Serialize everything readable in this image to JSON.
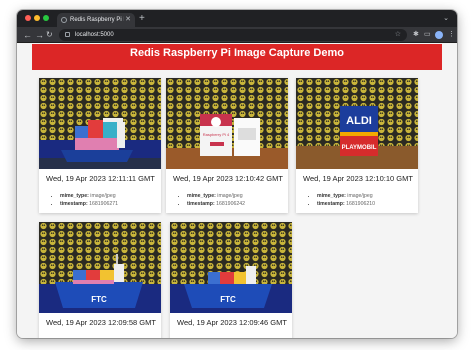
{
  "browser": {
    "tab_title": "Redis Raspberry Pi Image Captu",
    "url": "localhost:5000",
    "icons": [
      "close-icon",
      "plus-icon",
      "back-arrow-icon",
      "forward-arrow-icon",
      "reload-icon",
      "lock-icon",
      "star-icon",
      "extension-icon",
      "menu-icon"
    ]
  },
  "page": {
    "title": "Redis Raspberry Pi Image Capture Demo",
    "accent_color": "#dc2626"
  },
  "cards": [
    {
      "date": "Wed, 19 Apr 2023 12:11:11 GMT",
      "mime_label": "mime_type:",
      "mime_value": "image/jpeg",
      "ts_label": "timestamp:",
      "ts_value": "1681906271",
      "photo": "lego-boat-cargo-blocks"
    },
    {
      "date": "Wed, 19 Apr 2023 12:10:42 GMT",
      "mime_label": "mime_type:",
      "mime_value": "image/jpeg",
      "ts_label": "timestamp:",
      "ts_value": "1681906242",
      "photo": "raspberry-pi-boxes"
    },
    {
      "date": "Wed, 19 Apr 2023 12:10:10 GMT",
      "mime_label": "mime_type:",
      "mime_value": "image/jpeg",
      "ts_label": "timestamp:",
      "ts_value": "1681906210",
      "photo": "aldi-playmobil-boxes"
    },
    {
      "date": "Wed, 19 Apr 2023 12:09:58 GMT",
      "mime_label": "mime_type:",
      "mime_value": "image/jpeg",
      "ts_label": "timestamp:",
      "ts_value": "1681906198",
      "photo": "ftc-lego-boat"
    },
    {
      "date": "Wed, 19 Apr 2023 12:09:46 GMT",
      "mime_label": "mime_type:",
      "mime_value": "image/jpeg",
      "ts_label": "timestamp:",
      "ts_value": "1681906186",
      "photo": "ftc-lego-boat"
    }
  ],
  "photo_text": {
    "rpi_box": "Raspberry Pi 4",
    "aldi": "ALDI",
    "playmobil": "PLAYMOBIL",
    "ftc": "FTC"
  }
}
